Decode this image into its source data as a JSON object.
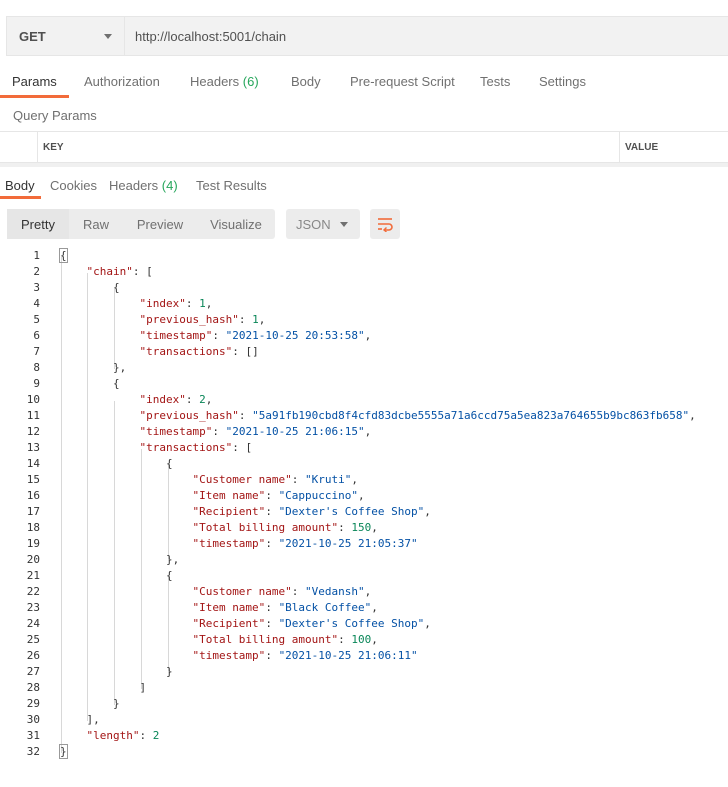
{
  "request": {
    "method": "GET",
    "url": "http://localhost:5001/chain"
  },
  "request_tabs": [
    {
      "label": "Params",
      "count": ""
    },
    {
      "label": "Authorization",
      "count": ""
    },
    {
      "label": "Headers",
      "count": "(6)"
    },
    {
      "label": "Body",
      "count": ""
    },
    {
      "label": "Pre-request Script",
      "count": ""
    },
    {
      "label": "Tests",
      "count": ""
    },
    {
      "label": "Settings",
      "count": ""
    }
  ],
  "query_params": {
    "title": "Query Params",
    "col_key": "KEY",
    "col_value": "VALUE"
  },
  "response_tabs": [
    {
      "label": "Body",
      "count": ""
    },
    {
      "label": "Cookies",
      "count": ""
    },
    {
      "label": "Headers",
      "count": "(4)"
    },
    {
      "label": "Test Results",
      "count": ""
    }
  ],
  "view_modes": [
    "Pretty",
    "Raw",
    "Preview",
    "Visualize"
  ],
  "format": "JSON",
  "icons": {
    "method_dropdown": "chevron-down-icon",
    "wrap": "wrap-lines-icon"
  },
  "colors": {
    "accent": "#f26b3a",
    "count": "#26a65b",
    "key": "#a31515",
    "string": "#0451a5",
    "number": "#098658"
  },
  "code_lines": [
    [
      {
        "t": "p",
        "v": "{"
      }
    ],
    [
      {
        "t": "p",
        "v": "    "
      },
      {
        "t": "k",
        "v": "\"chain\""
      },
      {
        "t": "p",
        "v": ": ["
      }
    ],
    [
      {
        "t": "p",
        "v": "        {"
      }
    ],
    [
      {
        "t": "p",
        "v": "            "
      },
      {
        "t": "k",
        "v": "\"index\""
      },
      {
        "t": "p",
        "v": ": "
      },
      {
        "t": "n",
        "v": "1"
      },
      {
        "t": "p",
        "v": ","
      }
    ],
    [
      {
        "t": "p",
        "v": "            "
      },
      {
        "t": "k",
        "v": "\"previous_hash\""
      },
      {
        "t": "p",
        "v": ": "
      },
      {
        "t": "n",
        "v": "1"
      },
      {
        "t": "p",
        "v": ","
      }
    ],
    [
      {
        "t": "p",
        "v": "            "
      },
      {
        "t": "k",
        "v": "\"timestamp\""
      },
      {
        "t": "p",
        "v": ": "
      },
      {
        "t": "s",
        "v": "\"2021-10-25 20:53:58\""
      },
      {
        "t": "p",
        "v": ","
      }
    ],
    [
      {
        "t": "p",
        "v": "            "
      },
      {
        "t": "k",
        "v": "\"transactions\""
      },
      {
        "t": "p",
        "v": ": []"
      }
    ],
    [
      {
        "t": "p",
        "v": "        },"
      }
    ],
    [
      {
        "t": "p",
        "v": "        {"
      }
    ],
    [
      {
        "t": "p",
        "v": "            "
      },
      {
        "t": "k",
        "v": "\"index\""
      },
      {
        "t": "p",
        "v": ": "
      },
      {
        "t": "n",
        "v": "2"
      },
      {
        "t": "p",
        "v": ","
      }
    ],
    [
      {
        "t": "p",
        "v": "            "
      },
      {
        "t": "k",
        "v": "\"previous_hash\""
      },
      {
        "t": "p",
        "v": ": "
      },
      {
        "t": "s",
        "v": "\"5a91fb190cbd8f4cfd83dcbe5555a71a6ccd75a5ea823a764655b9bc863fb658\""
      },
      {
        "t": "p",
        "v": ","
      }
    ],
    [
      {
        "t": "p",
        "v": "            "
      },
      {
        "t": "k",
        "v": "\"timestamp\""
      },
      {
        "t": "p",
        "v": ": "
      },
      {
        "t": "s",
        "v": "\"2021-10-25 21:06:15\""
      },
      {
        "t": "p",
        "v": ","
      }
    ],
    [
      {
        "t": "p",
        "v": "            "
      },
      {
        "t": "k",
        "v": "\"transactions\""
      },
      {
        "t": "p",
        "v": ": ["
      }
    ],
    [
      {
        "t": "p",
        "v": "                {"
      }
    ],
    [
      {
        "t": "p",
        "v": "                    "
      },
      {
        "t": "k",
        "v": "\"Customer name\""
      },
      {
        "t": "p",
        "v": ": "
      },
      {
        "t": "s",
        "v": "\"Kruti\""
      },
      {
        "t": "p",
        "v": ","
      }
    ],
    [
      {
        "t": "p",
        "v": "                    "
      },
      {
        "t": "k",
        "v": "\"Item name\""
      },
      {
        "t": "p",
        "v": ": "
      },
      {
        "t": "s",
        "v": "\"Cappuccino\""
      },
      {
        "t": "p",
        "v": ","
      }
    ],
    [
      {
        "t": "p",
        "v": "                    "
      },
      {
        "t": "k",
        "v": "\"Recipient\""
      },
      {
        "t": "p",
        "v": ": "
      },
      {
        "t": "s",
        "v": "\"Dexter's Coffee Shop\""
      },
      {
        "t": "p",
        "v": ","
      }
    ],
    [
      {
        "t": "p",
        "v": "                    "
      },
      {
        "t": "k",
        "v": "\"Total billing amount\""
      },
      {
        "t": "p",
        "v": ": "
      },
      {
        "t": "n",
        "v": "150"
      },
      {
        "t": "p",
        "v": ","
      }
    ],
    [
      {
        "t": "p",
        "v": "                    "
      },
      {
        "t": "k",
        "v": "\"timestamp\""
      },
      {
        "t": "p",
        "v": ": "
      },
      {
        "t": "s",
        "v": "\"2021-10-25 21:05:37\""
      }
    ],
    [
      {
        "t": "p",
        "v": "                },"
      }
    ],
    [
      {
        "t": "p",
        "v": "                {"
      }
    ],
    [
      {
        "t": "p",
        "v": "                    "
      },
      {
        "t": "k",
        "v": "\"Customer name\""
      },
      {
        "t": "p",
        "v": ": "
      },
      {
        "t": "s",
        "v": "\"Vedansh\""
      },
      {
        "t": "p",
        "v": ","
      }
    ],
    [
      {
        "t": "p",
        "v": "                    "
      },
      {
        "t": "k",
        "v": "\"Item name\""
      },
      {
        "t": "p",
        "v": ": "
      },
      {
        "t": "s",
        "v": "\"Black Coffee\""
      },
      {
        "t": "p",
        "v": ","
      }
    ],
    [
      {
        "t": "p",
        "v": "                    "
      },
      {
        "t": "k",
        "v": "\"Recipient\""
      },
      {
        "t": "p",
        "v": ": "
      },
      {
        "t": "s",
        "v": "\"Dexter's Coffee Shop\""
      },
      {
        "t": "p",
        "v": ","
      }
    ],
    [
      {
        "t": "p",
        "v": "                    "
      },
      {
        "t": "k",
        "v": "\"Total billing amount\""
      },
      {
        "t": "p",
        "v": ": "
      },
      {
        "t": "n",
        "v": "100"
      },
      {
        "t": "p",
        "v": ","
      }
    ],
    [
      {
        "t": "p",
        "v": "                    "
      },
      {
        "t": "k",
        "v": "\"timestamp\""
      },
      {
        "t": "p",
        "v": ": "
      },
      {
        "t": "s",
        "v": "\"2021-10-25 21:06:11\""
      }
    ],
    [
      {
        "t": "p",
        "v": "                }"
      }
    ],
    [
      {
        "t": "p",
        "v": "            ]"
      }
    ],
    [
      {
        "t": "p",
        "v": "        }"
      }
    ],
    [
      {
        "t": "p",
        "v": "    ],"
      }
    ],
    [
      {
        "t": "p",
        "v": "    "
      },
      {
        "t": "k",
        "v": "\"length\""
      },
      {
        "t": "p",
        "v": ": "
      },
      {
        "t": "n",
        "v": "2"
      }
    ],
    [
      {
        "t": "p",
        "v": "}"
      }
    ]
  ]
}
